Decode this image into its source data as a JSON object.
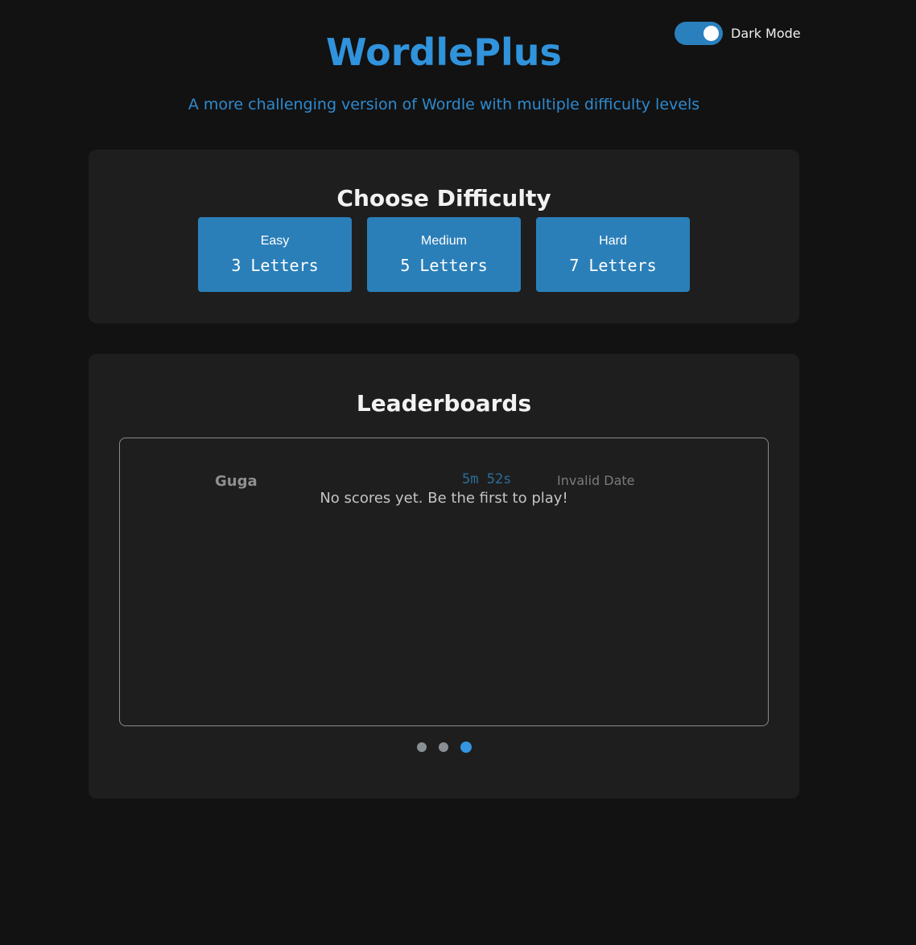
{
  "theme_toggle": {
    "label": "Dark Mode",
    "enabled": true
  },
  "header": {
    "title": "WordlePlus",
    "subtitle": "A more challenging version of Wordle with multiple difficulty levels"
  },
  "difficulty": {
    "heading": "Choose Difficulty",
    "options": [
      {
        "level": "Easy",
        "letters": "3 Letters"
      },
      {
        "level": "Medium",
        "letters": "5 Letters"
      },
      {
        "level": "Hard",
        "letters": "7 Letters"
      }
    ]
  },
  "leaderboards": {
    "heading": "Leaderboards",
    "entry": {
      "name": "Guga",
      "time": "5m 52s",
      "date": "Invalid Date"
    },
    "empty_message": "No scores yet. Be the first to play!",
    "pages_total": 3,
    "active_page": 3
  },
  "colors": {
    "accent": "#3093dc",
    "button": "#2b7fb9",
    "background": "#121212",
    "card": "#1e1e1e"
  }
}
